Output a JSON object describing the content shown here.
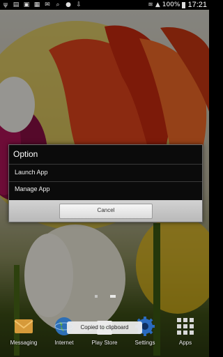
{
  "status_bar": {
    "battery_percent": "100%",
    "time": "17:21",
    "icons": [
      "usb-icon",
      "sd-card-icon",
      "image-icon",
      "gallery-icon",
      "mail-icon",
      "search-icon",
      "chat-icon",
      "download-icon",
      "wifi-icon",
      "signal-icon",
      "battery-icon"
    ]
  },
  "dialog": {
    "title": "Option",
    "items": [
      {
        "label": "Launch App"
      },
      {
        "label": "Manage App"
      }
    ],
    "cancel_label": "Cancel"
  },
  "dock": {
    "items": [
      {
        "label": "Messaging",
        "icon": "messaging-icon"
      },
      {
        "label": "Internet",
        "icon": "globe-icon"
      },
      {
        "label": "Play Store",
        "icon": "play-store-icon"
      },
      {
        "label": "Settings",
        "icon": "gear-icon"
      },
      {
        "label": "Apps",
        "icon": "apps-grid-icon"
      }
    ]
  },
  "toast": {
    "text": "Copied to clipboard"
  },
  "page_indicator": {
    "pages": 2,
    "current": 2
  }
}
